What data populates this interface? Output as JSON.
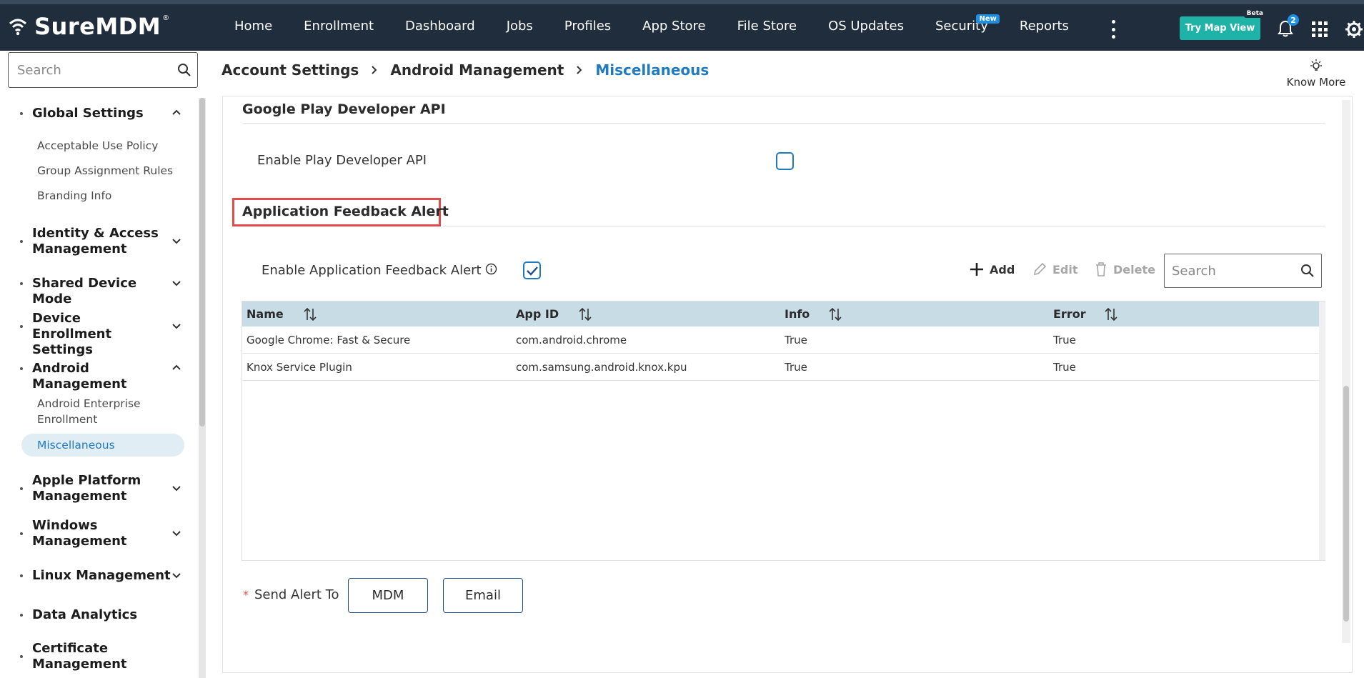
{
  "app": {
    "brand": "SureMDM",
    "reg_mark": "®"
  },
  "nav": {
    "items": [
      "Home",
      "Enrollment",
      "Dashboard",
      "Jobs",
      "Profiles",
      "App Store",
      "File Store",
      "OS Updates",
      "Security",
      "Reports"
    ],
    "security_badge": "New",
    "try_map_view": "Try Map View",
    "beta_badge": "Beta",
    "notification_count": "2"
  },
  "sidebar": {
    "search_placeholder": "Search",
    "groups": [
      {
        "label": "Global Settings",
        "expanded": true,
        "subitems": [
          "Acceptable Use Policy",
          "Group Assignment Rules",
          "Branding Info"
        ]
      },
      {
        "label": "Identity & Access Management",
        "expanded": false
      },
      {
        "label": "Shared Device Mode",
        "expanded": false
      },
      {
        "label": "Device Enrollment Settings",
        "expanded": false
      },
      {
        "label": "Android Management",
        "expanded": true,
        "subitems": [
          "Android Enterprise Enrollment",
          "Miscellaneous"
        ]
      },
      {
        "label": "Apple Platform Management",
        "expanded": false
      },
      {
        "label": "Windows Management",
        "expanded": false
      },
      {
        "label": "Linux Management",
        "expanded": false
      },
      {
        "label": "Data Analytics"
      },
      {
        "label": "Certificate Management"
      }
    ],
    "active_item": "Miscellaneous"
  },
  "breadcrumb": [
    "Account Settings",
    "Android Management",
    "Miscellaneous"
  ],
  "know_more": "Know More",
  "sections": {
    "play_api": {
      "title": "Google Play Developer API",
      "enable_label": "Enable Play Developer API",
      "enabled": false
    },
    "feedback": {
      "title": "Application Feedback Alert",
      "enable_label": "Enable Application Feedback Alert",
      "enabled": true,
      "toolbar": {
        "add": "Add",
        "edit": "Edit",
        "delete": "Delete",
        "search_placeholder": "Search"
      },
      "table": {
        "columns": [
          "Name",
          "App ID",
          "Info",
          "Error"
        ],
        "rows": [
          [
            "Google Chrome: Fast & Secure",
            "com.android.chrome",
            "True",
            "True"
          ],
          [
            "Knox Service Plugin",
            "com.samsung.android.knox.kpu",
            "True",
            "True"
          ]
        ]
      },
      "send_alert": {
        "label": "Send Alert To",
        "required_mark": "*",
        "buttons": [
          "MDM",
          "Email"
        ]
      }
    }
  },
  "colors": {
    "nav_bg": "#1f2d3d",
    "accent": "#1f7ac0",
    "teal": "#1fb3a8",
    "highlight": "#e24b4b",
    "table_header": "#c8dce6"
  }
}
